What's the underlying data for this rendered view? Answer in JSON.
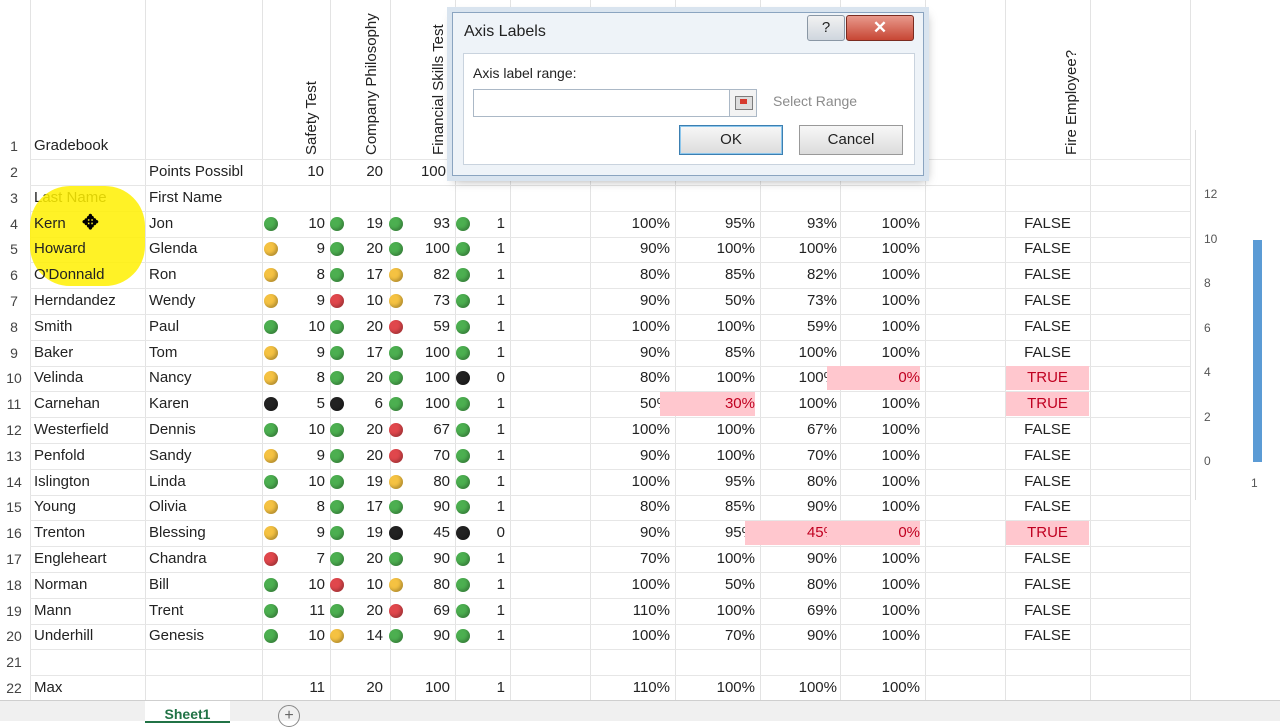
{
  "header_rows": {
    "row1_label": "Gradebook",
    "col_headers": [
      "Safety Test",
      "Company Philosophy",
      "Financial Skills Test",
      "Fire Employee?"
    ],
    "row2": {
      "label": "Points Possibl",
      "values": [
        "10",
        "20",
        "100"
      ]
    },
    "row3": {
      "last": "Last Name",
      "first": "First Name"
    }
  },
  "row_numbers": [
    "1",
    "2",
    "3",
    "4",
    "5",
    "6",
    "7",
    "8",
    "9",
    "10",
    "11",
    "12",
    "13",
    "14",
    "15",
    "16",
    "17",
    "18",
    "19",
    "20",
    "21",
    "22"
  ],
  "students": [
    {
      "last": "Kern",
      "first": "Jon",
      "d1": "green",
      "s1": "10",
      "d2": "green",
      "s2": "19",
      "d3": "green",
      "s3": "93",
      "d4": "green",
      "s4": "1",
      "p1": "100%",
      "p2": "95%",
      "p3": "93%",
      "p4": "100%",
      "fire": "FALSE"
    },
    {
      "last": "Howard",
      "first": "Glenda",
      "d1": "yellow",
      "s1": "9",
      "d2": "green",
      "s2": "20",
      "d3": "green",
      "s3": "100",
      "d4": "green",
      "s4": "1",
      "p1": "90%",
      "p2": "100%",
      "p3": "100%",
      "p4": "100%",
      "fire": "FALSE"
    },
    {
      "last": "O'Donnald",
      "first": "Ron",
      "d1": "yellow",
      "s1": "8",
      "d2": "green",
      "s2": "17",
      "d3": "yellow",
      "s3": "82",
      "d4": "green",
      "s4": "1",
      "p1": "80%",
      "p2": "85%",
      "p3": "82%",
      "p4": "100%",
      "fire": "FALSE"
    },
    {
      "last": "Herndandez",
      "first": "Wendy",
      "d1": "yellow",
      "s1": "9",
      "d2": "red",
      "s2": "10",
      "d3": "yellow",
      "s3": "73",
      "d4": "green",
      "s4": "1",
      "p1": "90%",
      "p2": "50%",
      "p3": "73%",
      "p4": "100%",
      "fire": "FALSE"
    },
    {
      "last": "Smith",
      "first": "Paul",
      "d1": "green",
      "s1": "10",
      "d2": "green",
      "s2": "20",
      "d3": "red",
      "s3": "59",
      "d4": "green",
      "s4": "1",
      "p1": "100%",
      "p2": "100%",
      "p3": "59%",
      "p4": "100%",
      "fire": "FALSE"
    },
    {
      "last": "Baker",
      "first": "Tom",
      "d1": "yellow",
      "s1": "9",
      "d2": "green",
      "s2": "17",
      "d3": "green",
      "s3": "100",
      "d4": "green",
      "s4": "1",
      "p1": "90%",
      "p2": "85%",
      "p3": "100%",
      "p4": "100%",
      "fire": "FALSE"
    },
    {
      "last": "Velinda",
      "first": "Nancy",
      "d1": "yellow",
      "s1": "8",
      "d2": "green",
      "s2": "20",
      "d3": "green",
      "s3": "100",
      "d4": "black",
      "s4": "0",
      "p1": "80%",
      "p2": "100%",
      "p3": "100%",
      "p4": "0%",
      "fire": "TRUE"
    },
    {
      "last": "Carnehan",
      "first": "Karen",
      "d1": "black",
      "s1": "5",
      "d2": "black",
      "s2": "6",
      "d3": "green",
      "s3": "100",
      "d4": "green",
      "s4": "1",
      "p1": "50%",
      "p2": "30%",
      "p3": "100%",
      "p4": "100%",
      "fire": "TRUE"
    },
    {
      "last": "Westerfield",
      "first": "Dennis",
      "d1": "green",
      "s1": "10",
      "d2": "green",
      "s2": "20",
      "d3": "red",
      "s3": "67",
      "d4": "green",
      "s4": "1",
      "p1": "100%",
      "p2": "100%",
      "p3": "67%",
      "p4": "100%",
      "fire": "FALSE"
    },
    {
      "last": "Penfold",
      "first": "Sandy",
      "d1": "yellow",
      "s1": "9",
      "d2": "green",
      "s2": "20",
      "d3": "red",
      "s3": "70",
      "d4": "green",
      "s4": "1",
      "p1": "90%",
      "p2": "100%",
      "p3": "70%",
      "p4": "100%",
      "fire": "FALSE"
    },
    {
      "last": "Islington",
      "first": "Linda",
      "d1": "green",
      "s1": "10",
      "d2": "green",
      "s2": "19",
      "d3": "yellow",
      "s3": "80",
      "d4": "green",
      "s4": "1",
      "p1": "100%",
      "p2": "95%",
      "p3": "80%",
      "p4": "100%",
      "fire": "FALSE"
    },
    {
      "last": "Young",
      "first": "Olivia",
      "d1": "yellow",
      "s1": "8",
      "d2": "green",
      "s2": "17",
      "d3": "green",
      "s3": "90",
      "d4": "green",
      "s4": "1",
      "p1": "80%",
      "p2": "85%",
      "p3": "90%",
      "p4": "100%",
      "fire": "FALSE"
    },
    {
      "last": "Trenton",
      "first": "Blessing",
      "d1": "yellow",
      "s1": "9",
      "d2": "green",
      "s2": "19",
      "d3": "black",
      "s3": "45",
      "d4": "black",
      "s4": "0",
      "p1": "90%",
      "p2": "95%",
      "p3": "45%",
      "p4": "0%",
      "fire": "TRUE"
    },
    {
      "last": "Engleheart",
      "first": "Chandra",
      "d1": "red",
      "s1": "7",
      "d2": "green",
      "s2": "20",
      "d3": "green",
      "s3": "90",
      "d4": "green",
      "s4": "1",
      "p1": "70%",
      "p2": "100%",
      "p3": "90%",
      "p4": "100%",
      "fire": "FALSE"
    },
    {
      "last": "Norman",
      "first": "Bill",
      "d1": "green",
      "s1": "10",
      "d2": "red",
      "s2": "10",
      "d3": "yellow",
      "s3": "80",
      "d4": "green",
      "s4": "1",
      "p1": "100%",
      "p2": "50%",
      "p3": "80%",
      "p4": "100%",
      "fire": "FALSE"
    },
    {
      "last": "Mann",
      "first": "Trent",
      "d1": "green",
      "s1": "11",
      "d2": "green",
      "s2": "20",
      "d3": "red",
      "s3": "69",
      "d4": "green",
      "s4": "1",
      "p1": "110%",
      "p2": "100%",
      "p3": "69%",
      "p4": "100%",
      "fire": "FALSE"
    },
    {
      "last": "Underhill",
      "first": "Genesis",
      "d1": "green",
      "s1": "10",
      "d2": "yellow",
      "s2": "14",
      "d3": "green",
      "s3": "90",
      "d4": "green",
      "s4": "1",
      "p1": "100%",
      "p2": "70%",
      "p3": "90%",
      "p4": "100%",
      "fire": "FALSE"
    }
  ],
  "max_row": {
    "label": "Max",
    "values": [
      "11",
      "20",
      "100",
      "1",
      "110%",
      "100%",
      "100%",
      "100%"
    ]
  },
  "highlighted_cells": [
    {
      "row": 6,
      "col": "p4"
    },
    {
      "row": 7,
      "col": "p2"
    },
    {
      "row": 12,
      "col": "p3"
    },
    {
      "row": 12,
      "col": "p4"
    }
  ],
  "colors": {
    "green": "#4caf50",
    "yellow": "#f5c242",
    "red": "#e0474c",
    "black": "#222222",
    "highlight": "#ffc7ce",
    "accent": "#217346"
  },
  "dialog": {
    "title": "Axis Labels",
    "help": "?",
    "close": "✕",
    "field_label": "Axis label range:",
    "field_value": "",
    "select_range": "Select Range",
    "ok": "OK",
    "cancel": "Cancel"
  },
  "sheet_tab": "Sheet1",
  "add_sheet": "+",
  "chart_fragment": {
    "y_ticks": [
      "12",
      "10",
      "8",
      "6",
      "4",
      "2",
      "0"
    ],
    "x_label": "1",
    "bar_value": 10,
    "y_max": 12
  }
}
